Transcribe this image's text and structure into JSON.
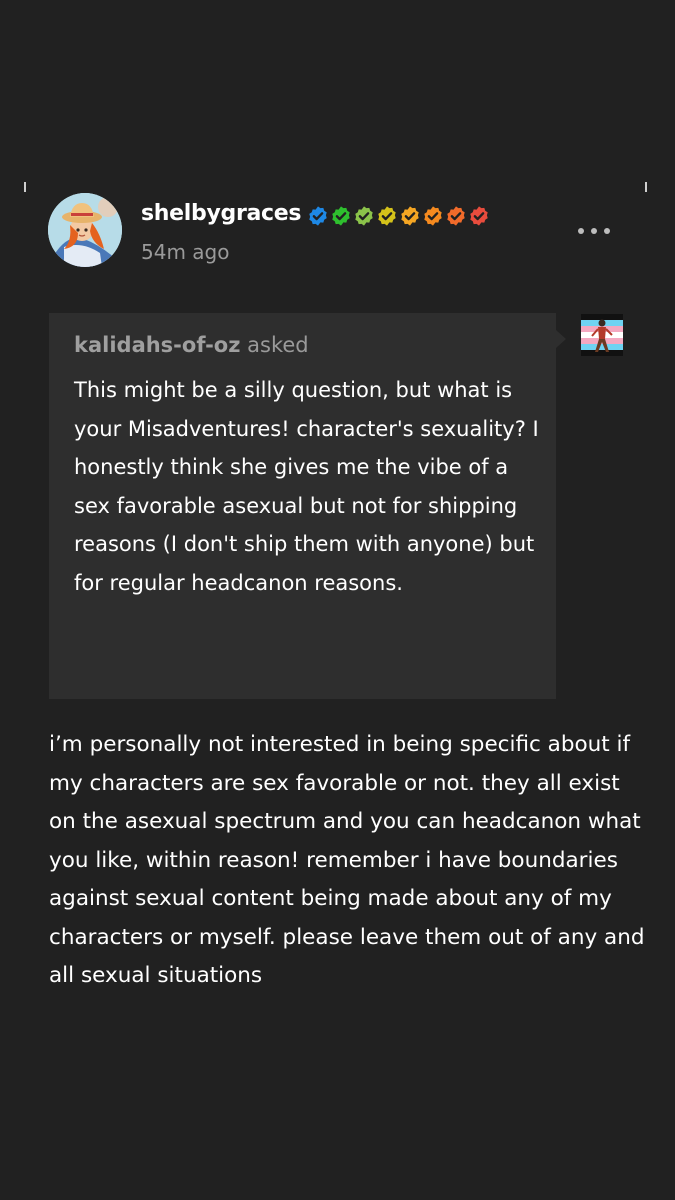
{
  "post": {
    "author": {
      "username": "shelbygraces",
      "avatar_icon": "cowgirl-avatar-icon",
      "badges": [
        {
          "icon": "checkmark-badge-icon",
          "color": "#1e88e5"
        },
        {
          "icon": "checkmark-badge-icon",
          "color": "#2ec02e"
        },
        {
          "icon": "checkmark-badge-icon",
          "color": "#8bc34a"
        },
        {
          "icon": "checkmark-badge-icon",
          "color": "#d4c21a"
        },
        {
          "icon": "checkmark-badge-icon",
          "color": "#f5a623"
        },
        {
          "icon": "checkmark-badge-icon",
          "color": "#f58a1f"
        },
        {
          "icon": "checkmark-badge-icon",
          "color": "#f26b2a"
        },
        {
          "icon": "checkmark-badge-icon",
          "color": "#e84c3d"
        }
      ]
    },
    "timestamp": "54m ago",
    "more_icon": "more-options-icon",
    "ask": {
      "asker": "kalidahs-of-oz",
      "asked_label": "asked",
      "asker_avatar_icon": "pride-flag-avatar-icon",
      "question": "This might be a silly question, but what is your Misadventures! character's sexuality? I honestly think she gives me the vibe of a sex favorable asexual but not for shipping reasons (I don't ship them with anyone) but for regular headcanon reasons."
    },
    "answer": "i’m personally not interested in being specific about if my characters are sex favorable or not. they all exist on the asexual spectrum and you can headcanon what you like, within reason! remember i have boundaries against sexual content being made about any of my characters or myself. please leave them out of any and all sexual situations"
  },
  "colors": {
    "background": "#212121",
    "ask_box": "#2e2e2e",
    "muted_text": "#9a9a9a"
  }
}
